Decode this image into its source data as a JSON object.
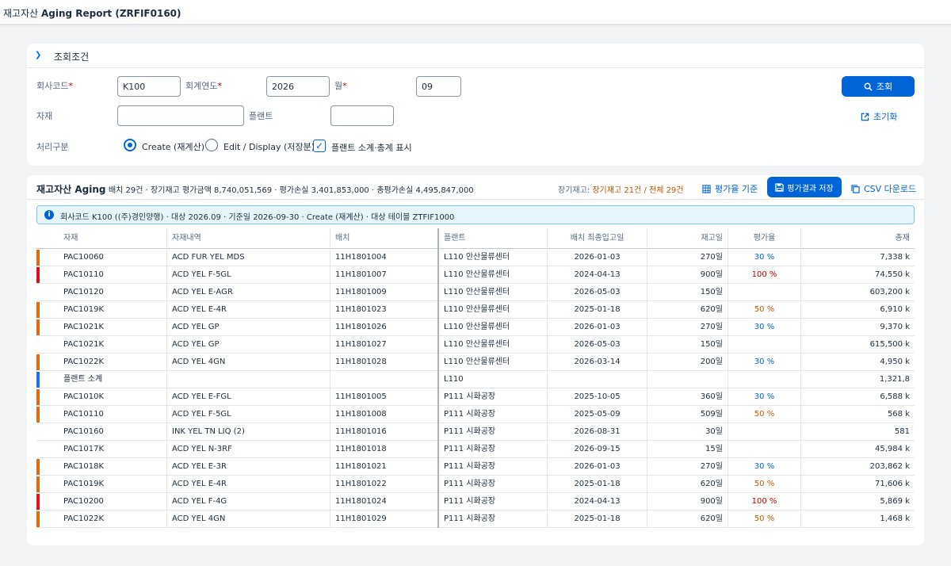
{
  "app": {
    "title_prefix": "재고자산 ",
    "title_bold": "Aging Report (ZRFIF0160)"
  },
  "filter": {
    "header": "조회조건",
    "company_label": "회사코드",
    "company_value": "K100",
    "fiscal_year_label": "회계연도",
    "fiscal_year_value": "2026",
    "month_label": "월",
    "month_value": "09",
    "material_label": "자재",
    "material_value": "",
    "plant_label": "플랜트",
    "plant_value": "",
    "process_label": "처리구분",
    "option_create": "Create (재계산)",
    "option_display": "Edit / Display (저장분)",
    "option_plant_subtotal": "플랜트 소계·총계 표시",
    "search_button": "조회",
    "reset_button": "초기화",
    "required_mark": "*"
  },
  "result": {
    "title": "재고자산 Aging",
    "summary": "배치 29건 · 장기재고 평가금액 8,740,051,569 · 평가손실 3,401,853,000 · 총평가손실 4,495,847,000",
    "aging_prefix": "장기재고: ",
    "aging_value": "장기재고 21건 / 전체 29건",
    "rate_basis_button": "평가율 기준",
    "save_button": "평가결과 저장",
    "csv_button": "CSV 다운로드",
    "info": "회사코드 K100 ((주)경인양행) · 대상 2026.09 · 기준일 2026-09-30 · Create (재계산) · 대상 테이블 ZTFIF1000"
  },
  "colors": {
    "accent": "#0064d9",
    "orange": "#e06b10",
    "red": "#e0101c",
    "blue": "#1a73e8"
  },
  "table": {
    "columns": [
      "자재",
      "자재내역",
      "배치",
      "플랜트",
      "배치 최종입고일",
      "재고일",
      "평가율",
      "총재"
    ],
    "rows": [
      {
        "marker": "orange",
        "material": "PAC10060",
        "desc": "ACD FUR YEL MDS",
        "batch": "11H1801004",
        "plant": "L110 안산물류센터",
        "date": "2026-01-03",
        "days": "270일",
        "rate": "30 %",
        "total": "7,338 k"
      },
      {
        "marker": "red",
        "material": "PAC10110",
        "desc": "ACD YEL F-5GL",
        "batch": "11H1801007",
        "plant": "L110 안산물류센터",
        "date": "2024-04-13",
        "days": "900일",
        "rate": "100 %",
        "total": "74,550 k"
      },
      {
        "marker": "",
        "material": "PAC10120",
        "desc": "ACD YEL E-AGR",
        "batch": "11H1801009",
        "plant": "L110 안산물류센터",
        "date": "2026-05-03",
        "days": "150일",
        "rate": "",
        "total": "603,200 k"
      },
      {
        "marker": "orange",
        "material": "PAC1019K",
        "desc": "ACD YEL E-4R",
        "batch": "11H1801023",
        "plant": "L110 안산물류센터",
        "date": "2025-01-18",
        "days": "620일",
        "rate": "50 %",
        "total": "6,910 k"
      },
      {
        "marker": "orange",
        "material": "PAC1021K",
        "desc": "ACD YEL GP",
        "batch": "11H1801026",
        "plant": "L110 안산물류센터",
        "date": "2026-01-03",
        "days": "270일",
        "rate": "30 %",
        "total": "9,370 k"
      },
      {
        "marker": "",
        "material": "PAC1021K",
        "desc": "ACD YEL GP",
        "batch": "11H1801027",
        "plant": "L110 안산물류센터",
        "date": "2026-05-03",
        "days": "150일",
        "rate": "",
        "total": "615,500 k"
      },
      {
        "marker": "orange",
        "material": "PAC1022K",
        "desc": "ACD YEL 4GN",
        "batch": "11H1801028",
        "plant": "L110 안산물류센터",
        "date": "2026-03-14",
        "days": "200일",
        "rate": "30 %",
        "total": "4,950 k"
      },
      {
        "marker": "blue",
        "material": "플랜트 소계",
        "desc": "",
        "batch": "",
        "plant": "L110",
        "date": "",
        "days": "",
        "rate": "",
        "total": "1,321,8"
      },
      {
        "marker": "orange",
        "material": "PAC1010K",
        "desc": "ACD YEL E-FGL",
        "batch": "11H1801005",
        "plant": "P111 시화공장",
        "date": "2025-10-05",
        "days": "360일",
        "rate": "30 %",
        "total": "6,588 k"
      },
      {
        "marker": "orange",
        "material": "PAC10110",
        "desc": "ACD YEL F-5GL",
        "batch": "11H1801008",
        "plant": "P111 시화공장",
        "date": "2025-05-09",
        "days": "509일",
        "rate": "50 %",
        "total": "568 k"
      },
      {
        "marker": "",
        "material": "PAC10160",
        "desc": "INK YEL TN LIQ (2)",
        "batch": "11H1801016",
        "plant": "P111 시화공장",
        "date": "2026-08-31",
        "days": "30일",
        "rate": "",
        "total": "581"
      },
      {
        "marker": "",
        "material": "PAC1017K",
        "desc": "ACD YEL N-3RF",
        "batch": "11H1801018",
        "plant": "P111 시화공장",
        "date": "2026-09-15",
        "days": "15일",
        "rate": "",
        "total": "45,984 k"
      },
      {
        "marker": "orange",
        "material": "PAC1018K",
        "desc": "ACD YEL E-3R",
        "batch": "11H1801021",
        "plant": "P111 시화공장",
        "date": "2026-01-03",
        "days": "270일",
        "rate": "30 %",
        "total": "203,862 k"
      },
      {
        "marker": "orange",
        "material": "PAC1019K",
        "desc": "ACD YEL E-4R",
        "batch": "11H1801022",
        "plant": "P111 시화공장",
        "date": "2025-01-18",
        "days": "620일",
        "rate": "50 %",
        "total": "71,606 k"
      },
      {
        "marker": "red",
        "material": "PAC10200",
        "desc": "ACD YEL F-4G",
        "batch": "11H1801024",
        "plant": "P111 시화공장",
        "date": "2024-04-13",
        "days": "900일",
        "rate": "100 %",
        "total": "5,869 k"
      },
      {
        "marker": "orange",
        "material": "PAC1022K",
        "desc": "ACD YEL 4GN",
        "batch": "11H1801029",
        "plant": "P111 시화공장",
        "date": "2025-01-18",
        "days": "620일",
        "rate": "50 %",
        "total": "1,468 k"
      }
    ]
  }
}
